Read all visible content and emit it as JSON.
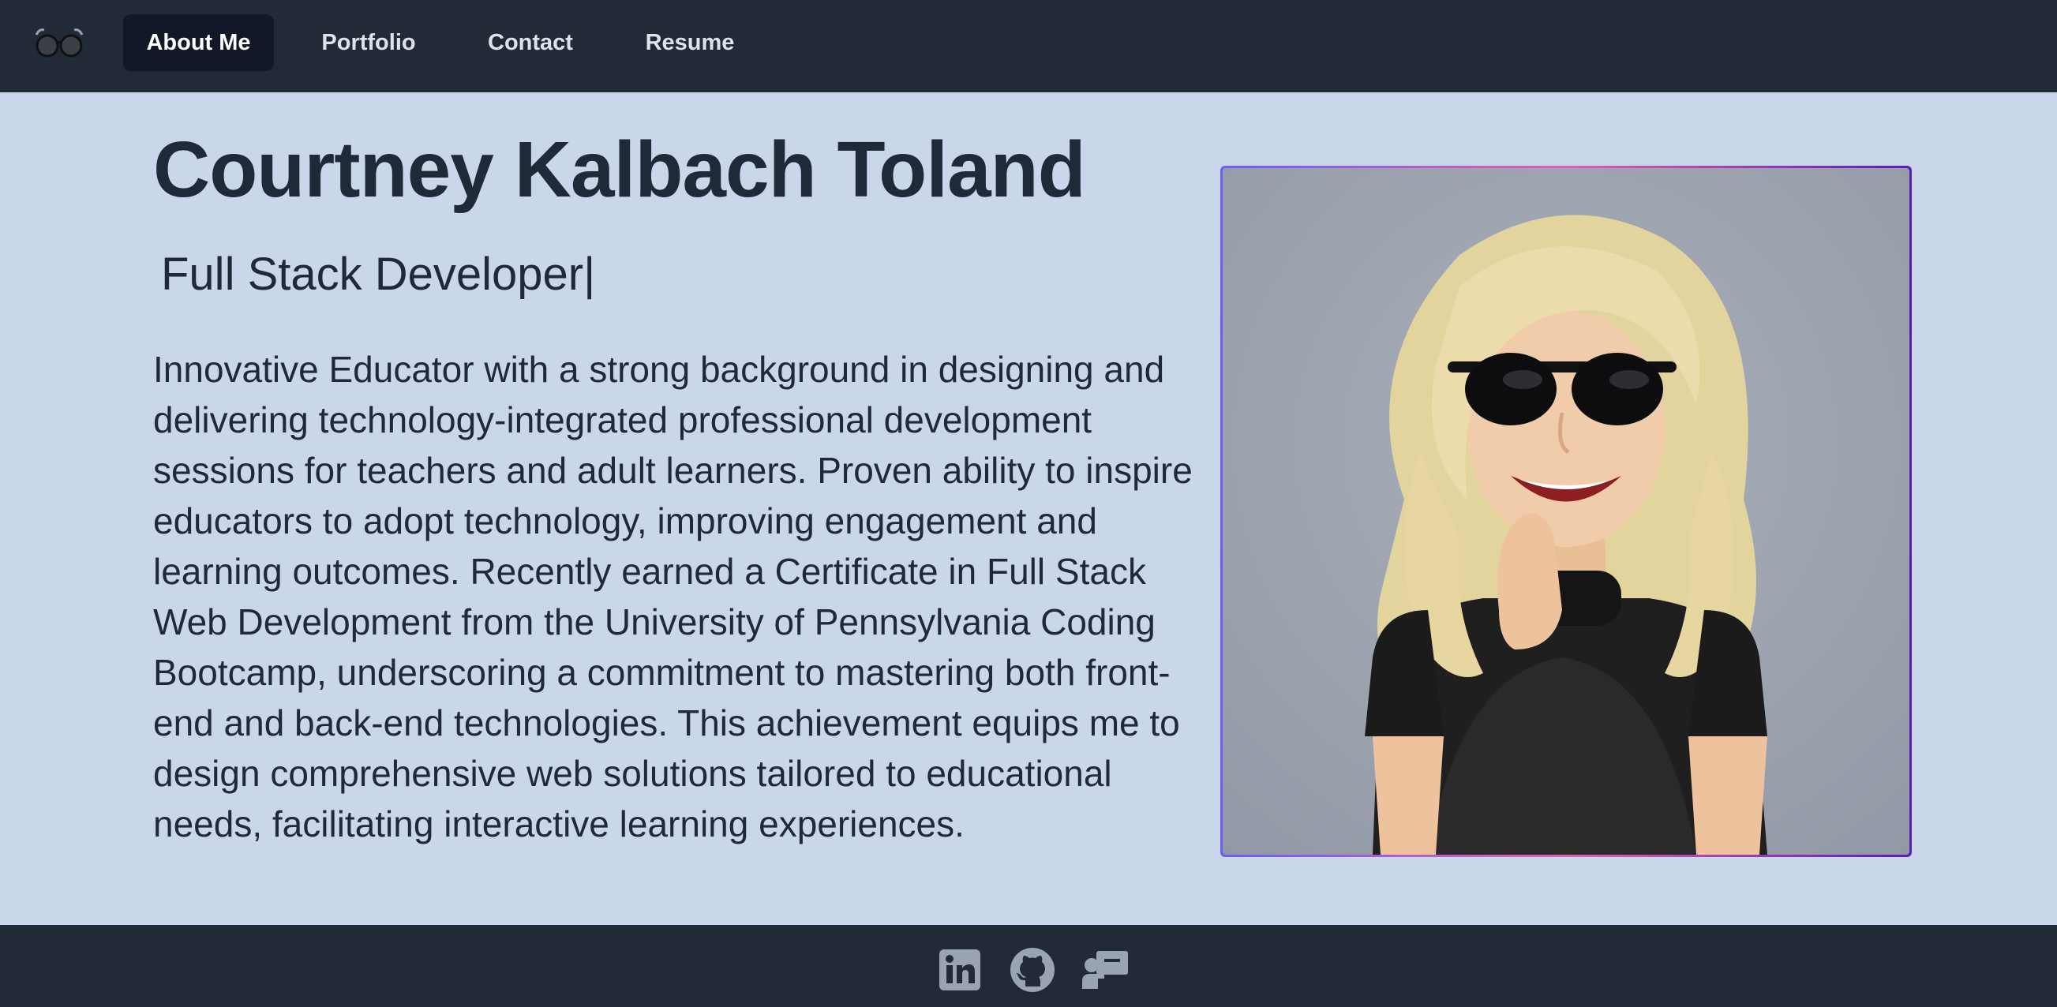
{
  "nav": {
    "logo_icon": "glasses-icon",
    "items": [
      {
        "label": "About Me",
        "active": true
      },
      {
        "label": "Portfolio",
        "active": false
      },
      {
        "label": "Contact",
        "active": false
      },
      {
        "label": "Resume",
        "active": false
      }
    ]
  },
  "hero": {
    "name": "Courtney Kalbach Toland",
    "role": "Full Stack Developer|",
    "bio": "Innovative Educator with a strong background in designing and delivering technology-integrated professional development sessions for teachers and adult learners. Proven ability to inspire educators to adopt technology, improving engagement and learning outcomes. Recently earned a Certificate in Full Stack Web Development from the University of Pennsylvania Coding Bootcamp, underscoring a commitment to mastering both front-end and back-end technologies. This achievement equips me to design comprehensive web solutions tailored to educational needs, facilitating interactive learning experiences.",
    "photo_icon": "avatar-illustration"
  },
  "footer": {
    "links": [
      {
        "icon": "linkedin-icon"
      },
      {
        "icon": "github-icon"
      },
      {
        "icon": "portfolio-presentation-icon"
      }
    ]
  },
  "colors": {
    "nav_bg": "#222937",
    "page_bg": "#cad7eb",
    "text": "#1f2937",
    "active_tab": "#111827",
    "footer_icon": "#9aa3b2"
  }
}
